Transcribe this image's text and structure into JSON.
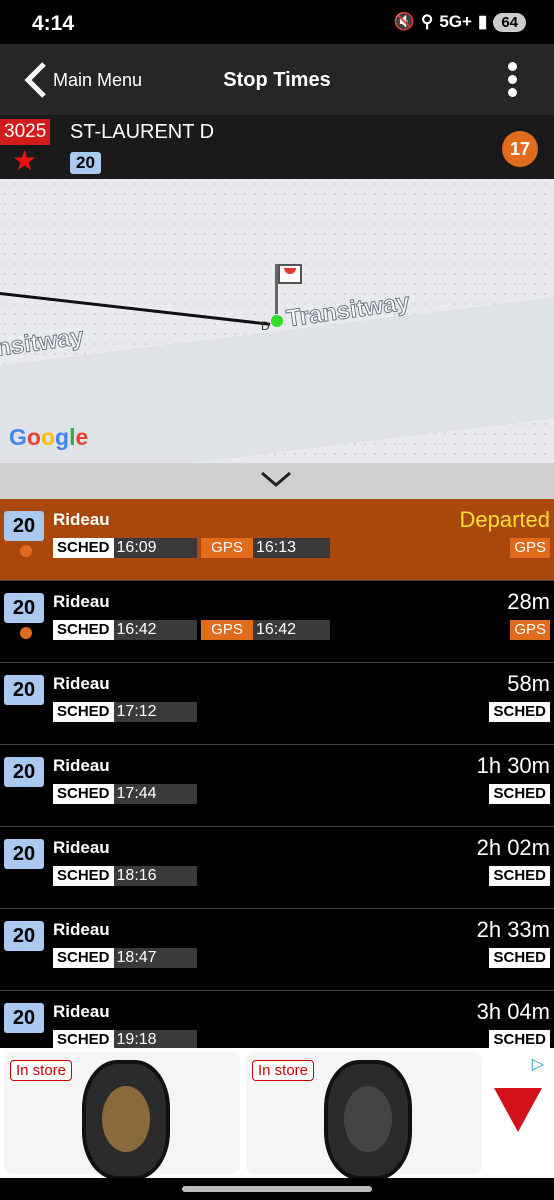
{
  "status_bar": {
    "time": "4:14",
    "network": "5G+",
    "battery": "64"
  },
  "header": {
    "back_label": "Main Menu",
    "title": "Stop Times"
  },
  "stop": {
    "number": "3025",
    "name": "ST-LAURENT D",
    "route": "20",
    "count": "17"
  },
  "map": {
    "labels": [
      "Transitway",
      "nsitway"
    ],
    "marker_letter": "D",
    "logo": "Google"
  },
  "departures": [
    {
      "route": "20",
      "destination": "Rideau",
      "sched_tag": "SCHED",
      "sched_time": "16:09",
      "gps_tag": "GPS",
      "gps_time": "16:13",
      "eta": "Departed",
      "source": "GPS",
      "highlighted": true,
      "live": true
    },
    {
      "route": "20",
      "destination": "Rideau",
      "sched_tag": "SCHED",
      "sched_time": "16:42",
      "gps_tag": "GPS",
      "gps_time": "16:42",
      "eta": "28m",
      "source": "GPS",
      "highlighted": false,
      "live": true
    },
    {
      "route": "20",
      "destination": "Rideau",
      "sched_tag": "SCHED",
      "sched_time": "17:12",
      "eta": "58m",
      "source": "SCHED",
      "highlighted": false,
      "live": false
    },
    {
      "route": "20",
      "destination": "Rideau",
      "sched_tag": "SCHED",
      "sched_time": "17:44",
      "eta": "1h 30m",
      "source": "SCHED",
      "highlighted": false,
      "live": false
    },
    {
      "route": "20",
      "destination": "Rideau",
      "sched_tag": "SCHED",
      "sched_time": "18:16",
      "eta": "2h 02m",
      "source": "SCHED",
      "highlighted": false,
      "live": false
    },
    {
      "route": "20",
      "destination": "Rideau",
      "sched_tag": "SCHED",
      "sched_time": "18:47",
      "eta": "2h 33m",
      "source": "SCHED",
      "highlighted": false,
      "live": false
    },
    {
      "route": "20",
      "destination": "Rideau",
      "sched_tag": "SCHED",
      "sched_time": "19:18",
      "eta": "3h 04m",
      "source": "SCHED",
      "highlighted": false,
      "live": false
    }
  ],
  "ad": {
    "cards": [
      {
        "badge": "In store",
        "rim": "bronze"
      },
      {
        "badge": "In store",
        "rim": "dark"
      }
    ],
    "adchoice": "▷"
  },
  "colors": {
    "accent": "#e06b1c",
    "highlight_row": "#a8480c",
    "route_chip": "#a9c9f0",
    "stop_number": "#d01c1c",
    "departed": "#ffdd33"
  }
}
